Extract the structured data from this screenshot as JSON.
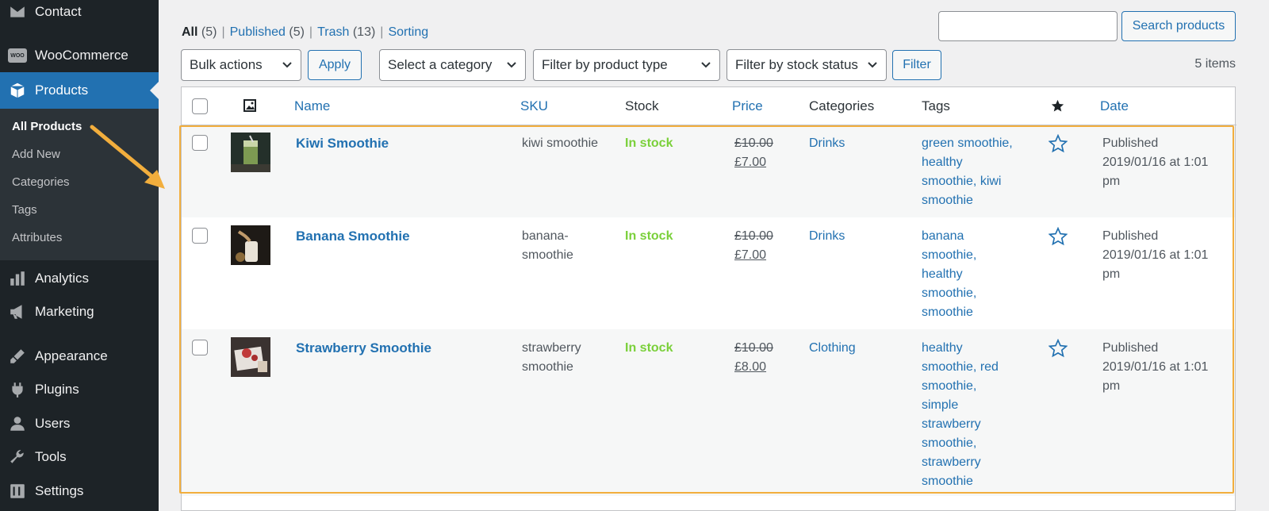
{
  "sidebar": {
    "contact_label": "Contact",
    "woocommerce_label": "WooCommerce",
    "woo_badge": "WOO",
    "products_label": "Products",
    "submenu": [
      "All Products",
      "Add New",
      "Categories",
      "Tags",
      "Attributes"
    ],
    "analytics_label": "Analytics",
    "marketing_label": "Marketing",
    "appearance_label": "Appearance",
    "plugins_label": "Plugins",
    "users_label": "Users",
    "tools_label": "Tools",
    "settings_label": "Settings"
  },
  "views": {
    "all_label": "All",
    "all_count": "(5)",
    "published_label": "Published",
    "published_count": "(5)",
    "trash_label": "Trash",
    "trash_count": "(13)",
    "sorting_label": "Sorting",
    "separator": "|"
  },
  "search": {
    "value": "",
    "button_label": "Search products"
  },
  "toolbar": {
    "bulk_actions": "Bulk actions",
    "apply_label": "Apply",
    "category_select": "Select a category",
    "product_type_select": "Filter by product type",
    "stock_status_select": "Filter by stock status",
    "filter_label": "Filter",
    "items_count": "5 items"
  },
  "table": {
    "headers": {
      "name": "Name",
      "sku": "SKU",
      "stock": "Stock",
      "price": "Price",
      "categories": "Categories",
      "tags": "Tags",
      "date": "Date"
    },
    "rows": [
      {
        "name": "Kiwi Smoothie",
        "sku": [
          "kiwi smoothie"
        ],
        "stock": "In stock",
        "price_old": "£10.00",
        "price_new": "£7.00",
        "category": "Drinks",
        "tags": [
          "green smoothie,",
          "healthy",
          "smoothie, kiwi",
          "smoothie"
        ],
        "date": [
          "Published",
          "2019/01/16 at 1:01",
          "pm"
        ]
      },
      {
        "name": "Banana Smoothie",
        "sku": [
          "banana-",
          "smoothie"
        ],
        "stock": "In stock",
        "price_old": "£10.00",
        "price_new": "£7.00",
        "category": "Drinks",
        "tags": [
          "banana",
          "smoothie,",
          "healthy",
          "smoothie,",
          "smoothie"
        ],
        "date": [
          "Published",
          "2019/01/16 at 1:01",
          "pm"
        ]
      },
      {
        "name": "Strawberry Smoothie",
        "sku": [
          "strawberry",
          "smoothie"
        ],
        "stock": "In stock",
        "price_old": "£10.00",
        "price_new": "£8.00",
        "category": "Clothing",
        "tags": [
          "healthy",
          "smoothie, red",
          "smoothie,",
          "simple",
          "strawberry",
          "smoothie,",
          "strawberry",
          "smoothie"
        ],
        "date": [
          "Published",
          "2019/01/16 at 1:01",
          "pm"
        ]
      }
    ]
  },
  "colors": {
    "sidebar_bg": "#1d2327",
    "active_bg": "#2271b1",
    "link": "#2271b1",
    "in_stock": "#7ad03a",
    "highlight": "#f2ae3d"
  }
}
